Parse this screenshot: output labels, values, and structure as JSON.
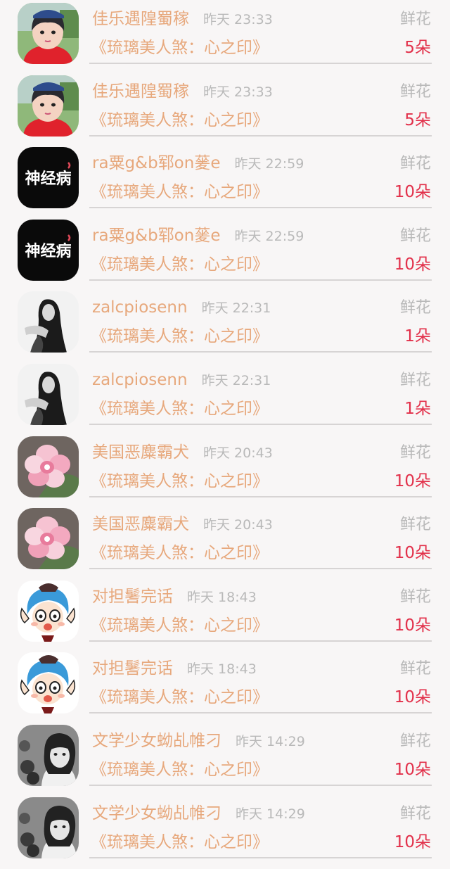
{
  "items": [
    {
      "name": "佳乐遇隍蜀稼",
      "time": "昨天 23:33",
      "gift": "鲜花",
      "book": "《琉璃美人煞：心之印》",
      "qty": "5朵",
      "avatar": "boy-photo-avatar"
    },
    {
      "name": "佳乐遇隍蜀稼",
      "time": "昨天 23:33",
      "gift": "鲜花",
      "book": "《琉璃美人煞：心之印》",
      "qty": "5朵",
      "avatar": "boy-photo-avatar"
    },
    {
      "name": "ra粟g&b郓on蓌e",
      "time": "昨天 22:59",
      "gift": "鲜花",
      "book": "《琉璃美人煞：心之印》",
      "qty": "10朵",
      "avatar": "text-logo-avatar",
      "avatar_text": "神经病"
    },
    {
      "name": "ra粟g&b郓on蓌e",
      "time": "昨天 22:59",
      "gift": "鲜花",
      "book": "《琉璃美人煞：心之印》",
      "qty": "10朵",
      "avatar": "text-logo-avatar",
      "avatar_text": "神经病"
    },
    {
      "name": "zalcpiosenn",
      "time": "昨天 22:31",
      "gift": "鲜花",
      "book": "《琉璃美人煞：心之印》",
      "qty": "1朵",
      "avatar": "woman-bw-photo-avatar"
    },
    {
      "name": "zalcpiosenn",
      "time": "昨天 22:31",
      "gift": "鲜花",
      "book": "《琉璃美人煞：心之印》",
      "qty": "1朵",
      "avatar": "woman-bw-photo-avatar"
    },
    {
      "name": "美国恶麋霸犬",
      "time": "昨天 20:43",
      "gift": "鲜花",
      "book": "《琉璃美人煞：心之印》",
      "qty": "10朵",
      "avatar": "pink-flower-avatar"
    },
    {
      "name": "美国恶麋霸犬",
      "time": "昨天 20:43",
      "gift": "鲜花",
      "book": "《琉璃美人煞：心之印》",
      "qty": "10朵",
      "avatar": "pink-flower-avatar"
    },
    {
      "name": "对担鬐完话",
      "time": "昨天 18:43",
      "gift": "鲜花",
      "book": "《琉璃美人煞：心之印》",
      "qty": "10朵",
      "avatar": "anime-character-avatar"
    },
    {
      "name": "对担鬐完话",
      "time": "昨天 18:43",
      "gift": "鲜花",
      "book": "《琉璃美人煞：心之印》",
      "qty": "10朵",
      "avatar": "anime-character-avatar"
    },
    {
      "name": "文学少女蚴乩帷刁",
      "time": "昨天 14:29",
      "gift": "鲜花",
      "book": "《琉璃美人煞：心之印》",
      "qty": "10朵",
      "avatar": "girl-bw-photo-avatar"
    },
    {
      "name": "文学少女蚴乩帷刁",
      "time": "昨天 14:29",
      "gift": "鲜花",
      "book": "《琉璃美人煞：心之印》",
      "qty": "10朵",
      "avatar": "girl-bw-photo-avatar"
    }
  ]
}
